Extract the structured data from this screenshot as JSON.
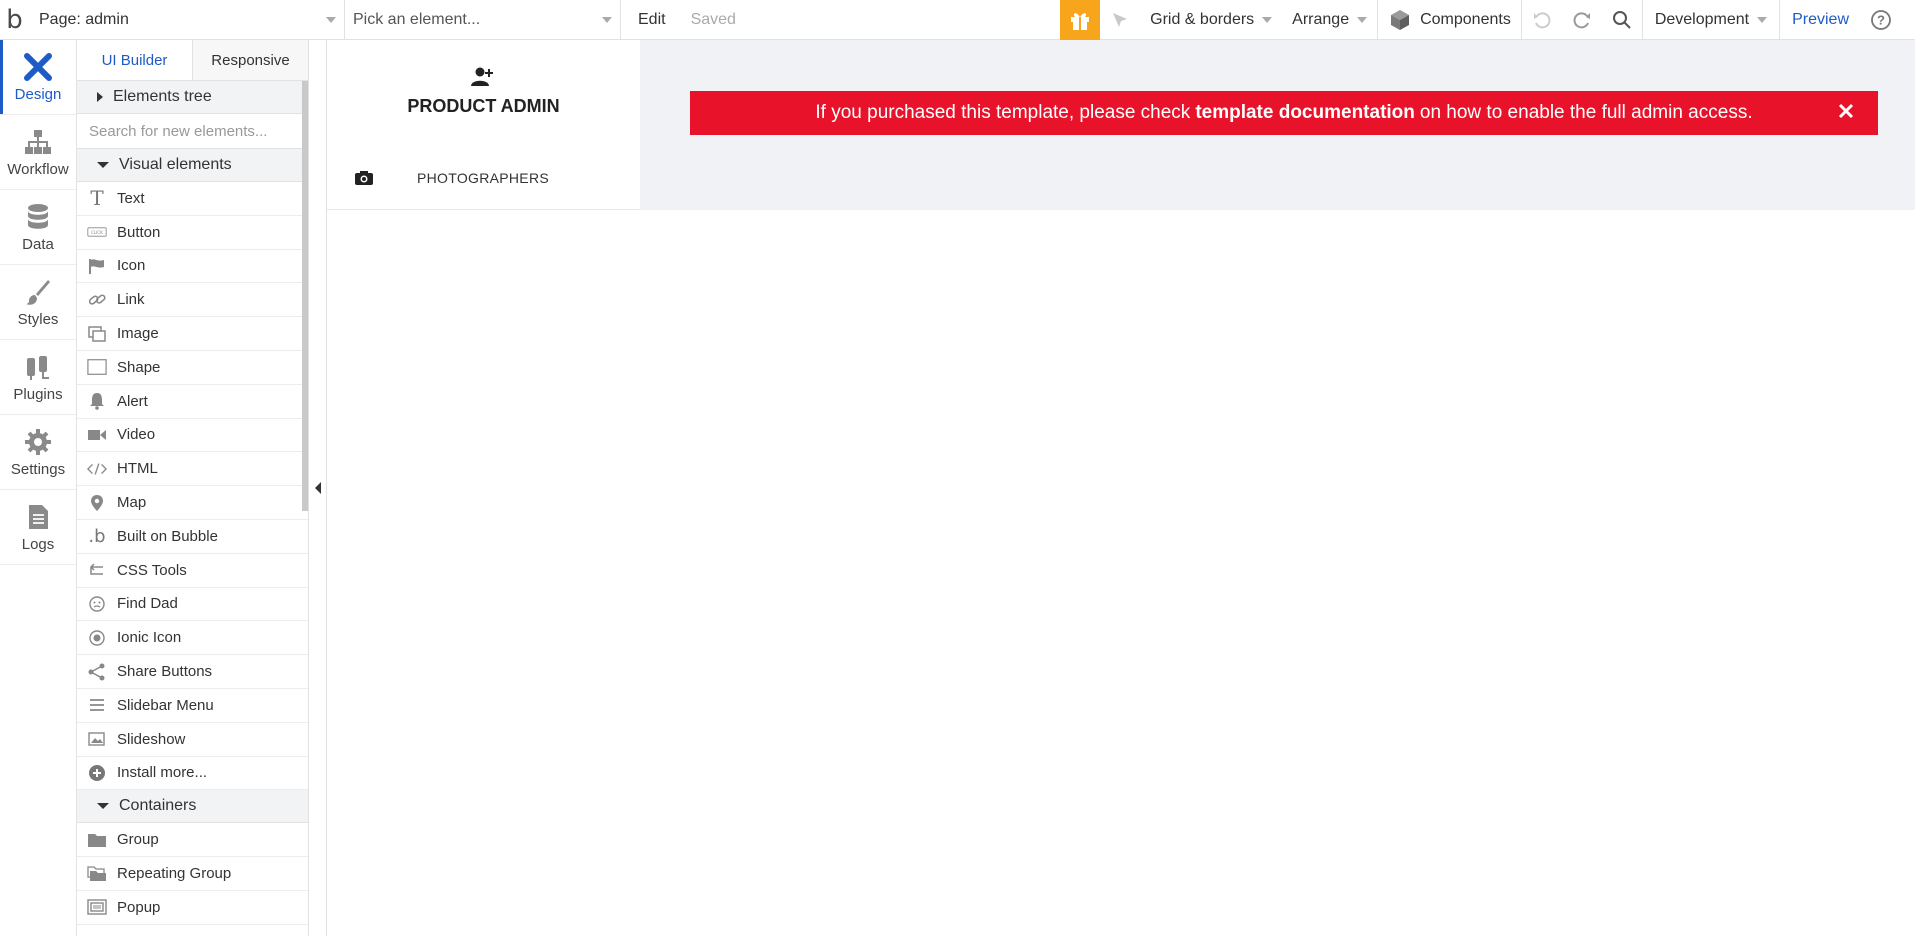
{
  "topbar": {
    "logo": "b",
    "page_select": "Page: admin",
    "element_picker": "Pick an element...",
    "edit_label": "Edit",
    "saved_label": "Saved",
    "grid_label": "Grid & borders",
    "arrange_label": "Arrange",
    "components_label": "Components",
    "environment_label": "Development",
    "preview_label": "Preview"
  },
  "leftnav": {
    "items": [
      {
        "label": "Design",
        "icon": "design-icon"
      },
      {
        "label": "Workflow",
        "icon": "workflow-icon"
      },
      {
        "label": "Data",
        "icon": "database-icon"
      },
      {
        "label": "Styles",
        "icon": "brush-icon"
      },
      {
        "label": "Plugins",
        "icon": "plug-icon"
      },
      {
        "label": "Settings",
        "icon": "gear-icon"
      },
      {
        "label": "Logs",
        "icon": "document-icon"
      }
    ]
  },
  "palette": {
    "tabs": [
      "UI Builder",
      "Responsive"
    ],
    "elements_tree_label": "Elements tree",
    "search_placeholder": "Search for new elements...",
    "visual_section": "Visual elements",
    "visual_items": [
      "Text",
      "Button",
      "Icon",
      "Link",
      "Image",
      "Shape",
      "Alert",
      "Video",
      "HTML",
      "Map",
      "Built on Bubble",
      "CSS Tools",
      "Find Dad",
      "Ionic Icon",
      "Share Buttons",
      "Slidebar Menu",
      "Slideshow",
      "Install more..."
    ],
    "containers_section": "Containers",
    "container_items": [
      "Group",
      "Repeating Group",
      "Popup"
    ]
  },
  "canvas": {
    "admin_title": "PRODUCT ADMIN",
    "photographers_label": "PHOTOGRAPHERS",
    "alert": {
      "text_before": "If you purchased this template, please check",
      "link_text": "template documentation",
      "text_after": "on how to enable the full admin access."
    }
  },
  "colors": {
    "accent": "#1e5bc6",
    "alert_red": "#e8122a",
    "gift_orange": "#f7a51c",
    "canvas_header_bg": "#f0f2f5"
  }
}
